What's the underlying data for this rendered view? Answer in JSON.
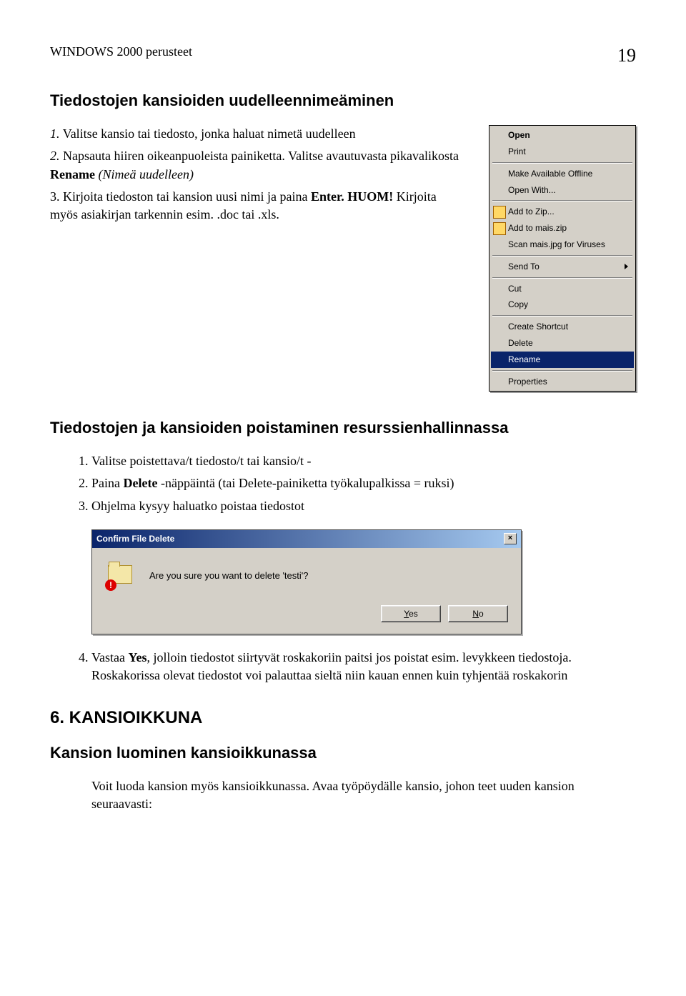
{
  "header": {
    "left": "WINDOWS 2000 perusteet",
    "page_number": "19"
  },
  "section1": {
    "title": "Tiedostojen kansioiden uudelleennimeäminen",
    "step1_prefix": "1.",
    "step1": "Valitse kansio tai tiedosto, jonka haluat nimetä uudelleen",
    "step2_prefix": "2.",
    "step2_part1": "Napsauta hiiren oikeanpuoleista painiketta. Valitse avautuvasta pikavalikosta ",
    "step2_bold": "Rename",
    "step2_italic": " (Nimeä uudelleen)",
    "step3_prefix": "3.",
    "step3_part1": "Kirjoita tiedoston tai kansion uusi nimi ja paina ",
    "step3_bold1": "Enter.",
    "step3_part2": " ",
    "step3_bold2": "HUOM!",
    "step3_part3": " Kirjoita myös asiakirjan tarkennin esim. .doc tai .xls."
  },
  "context_menu": {
    "open": "Open",
    "print": "Print",
    "make_offline": "Make Available Offline",
    "open_with": "Open With...",
    "add_zip": "Add to Zip...",
    "add_mais": "Add to mais.zip",
    "scan": "Scan mais.jpg for Viruses",
    "send_to": "Send To",
    "cut": "Cut",
    "copy": "Copy",
    "shortcut": "Create Shortcut",
    "delete": "Delete",
    "rename": "Rename",
    "properties": "Properties"
  },
  "section2": {
    "title": "Tiedostojen ja kansioiden poistaminen resurssienhallinnassa",
    "step1": "Valitse poistettava/t tiedosto/t tai kansio/t -",
    "step2_part1": "Paina ",
    "step2_bold": "Delete",
    "step2_part2": " -näppäintä (tai Delete-painiketta työkalupalkissa = ruksi)",
    "step3": "Ohjelma kysyy haluatko poistaa tiedostot"
  },
  "dialog": {
    "title": "Confirm File Delete",
    "message": "Are you sure you want to delete 'testi'?",
    "yes": "Yes",
    "no": "No"
  },
  "section2_step4": {
    "part1": "Vastaa ",
    "bold": "Yes",
    "part2": ", jolloin tiedostot siirtyvät roskakoriin paitsi jos poistat esim. levykkeen tiedostoja. Roskakorissa olevat tiedostot voi palauttaa sieltä niin kauan ennen kuin tyhjentää roskakorin"
  },
  "section3": {
    "main_title": "6. KANSIOIKKUNA",
    "sub_title": "Kansion luominen kansioikkunassa",
    "body": "Voit luoda kansion myös kansioikkunassa. Avaa työpöydälle kansio, johon teet uuden kansion seuraavasti:"
  }
}
